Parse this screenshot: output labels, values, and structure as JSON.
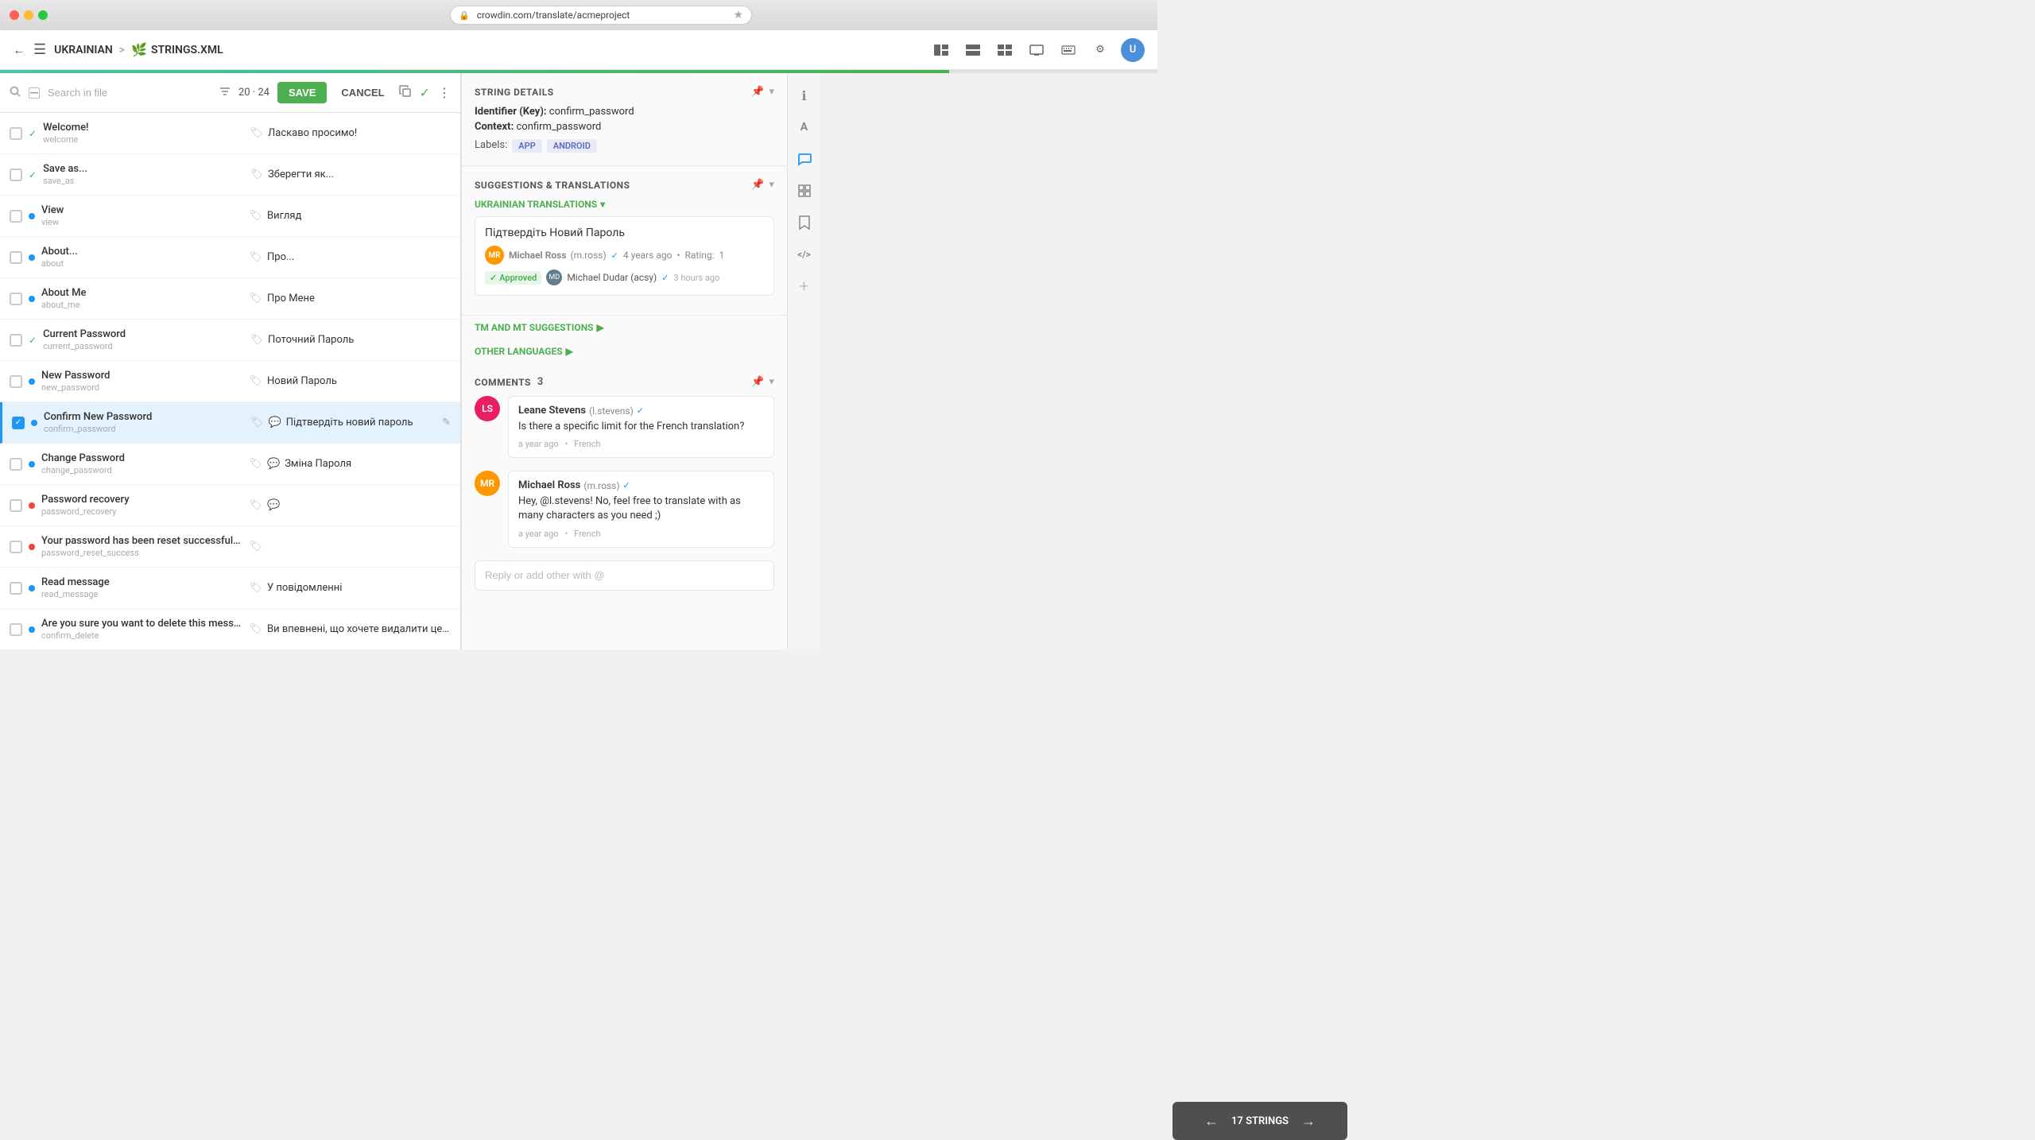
{
  "titlebar": {
    "url": "crowdin.com/translate/acmeproject",
    "star": "★"
  },
  "topbar": {
    "language": "UKRAINIAN",
    "separator": ">",
    "filename": "STRINGS.XML",
    "progress": 82
  },
  "searchbar": {
    "placeholder": "Search in file",
    "counter": "20 · 24",
    "save_label": "SAVE",
    "cancel_label": "CANCEL"
  },
  "strings": [
    {
      "id": 1,
      "key": "Welcome!",
      "slug": "welcome",
      "status": "approved",
      "translation": "Ласкаво просимо!",
      "hasTag": true,
      "hasComment": false
    },
    {
      "id": 2,
      "key": "Save as...",
      "slug": "save_as",
      "status": "approved",
      "translation": "Зберегти як...",
      "hasTag": true,
      "hasComment": false
    },
    {
      "id": 3,
      "key": "View",
      "slug": "view",
      "status": "blue",
      "translation": "Вигляд",
      "hasTag": true,
      "hasComment": false
    },
    {
      "id": 4,
      "key": "About...",
      "slug": "about",
      "status": "blue",
      "translation": "Про...",
      "hasTag": true,
      "hasComment": false
    },
    {
      "id": 5,
      "key": "About Me",
      "slug": "about_me",
      "status": "blue",
      "translation": "Про Мене",
      "hasTag": true,
      "hasComment": false
    },
    {
      "id": 6,
      "key": "Current Password",
      "slug": "current_password",
      "status": "approved",
      "translation": "Поточний Пароль",
      "hasTag": true,
      "hasComment": false
    },
    {
      "id": 7,
      "key": "New Password",
      "slug": "new_password",
      "status": "blue",
      "translation": "Новий Пароль",
      "hasTag": true,
      "hasComment": false
    },
    {
      "id": 8,
      "key": "Confirm New Password",
      "slug": "confirm_password",
      "status": "active",
      "translation": "Підтвердіть новий пароль",
      "hasTag": true,
      "hasComment": true,
      "isActive": true
    },
    {
      "id": 9,
      "key": "Change Password",
      "slug": "change_password",
      "status": "blue",
      "translation": "Зміна Пароля",
      "hasTag": true,
      "hasComment": true
    },
    {
      "id": 10,
      "key": "Password recovery",
      "slug": "password_recovery",
      "status": "red",
      "translation": "",
      "hasTag": true,
      "hasComment": true
    },
    {
      "id": 11,
      "key": "Your password has been reset successfully!",
      "slug": "password_reset_success",
      "status": "red",
      "translation": "",
      "hasTag": true,
      "hasComment": false
    },
    {
      "id": 12,
      "key": "Read message",
      "slug": "read_message",
      "status": "blue",
      "translation": "У повідомленні",
      "hasTag": true,
      "hasComment": false
    },
    {
      "id": 13,
      "key": "Are you sure you want to delete this message?",
      "slug": "confirm_delete",
      "status": "blue",
      "translation": "Ви впевнені, що хочете видалити це повідомлення?",
      "hasTag": true,
      "hasComment": false
    }
  ],
  "bottom_overlay": {
    "label": "17 STRINGS",
    "prev": "←",
    "next": "→"
  },
  "string_details": {
    "section_title": "STRING DETAILS",
    "identifier_label": "Identifier (Key):",
    "identifier_value": "confirm_password",
    "context_label": "Context:",
    "context_value": "confirm_password",
    "labels_title": "Labels:",
    "labels": [
      "APP",
      "ANDROID"
    ]
  },
  "suggestions": {
    "section_title": "SUGGESTIONS & TRANSLATIONS",
    "lang_label": "UKRAINIAN TRANSLATIONS",
    "suggestion_text": "Підтвердіть Новий Пароль",
    "author_name": "Michael Ross",
    "author_username": "(m.ross)",
    "time": "4 years ago",
    "rating_label": "Rating:",
    "rating": "1",
    "approved_label": "Approved",
    "approver_name": "Michael Dudar (acsy)",
    "approver_time": "3 hours ago",
    "tm_label": "TM AND MT SUGGESTIONS",
    "other_label": "OTHER LANGUAGES"
  },
  "comments": {
    "section_title": "COMMENTS",
    "count": "3",
    "items": [
      {
        "author_name": "Leane Stevens",
        "author_username": "(l.stevens)",
        "verified": true,
        "text": "Is there a specific limit for the French translation?",
        "time": "a year ago",
        "lang": "French",
        "initials": "LS"
      },
      {
        "author_name": "Michael Ross",
        "author_username": "(m.ross)",
        "verified": true,
        "text": "Hey, @l.stevens! No, feel free to translate with as many characters as you need ;)",
        "time": "a year ago",
        "lang": "French",
        "initials": "MR"
      }
    ],
    "reply_placeholder": "Reply or add other with @"
  },
  "far_right_icons": [
    {
      "name": "info-icon",
      "symbol": "ℹ",
      "active": false
    },
    {
      "name": "translate-icon",
      "symbol": "A",
      "active": false
    },
    {
      "name": "comments-icon",
      "symbol": "💬",
      "active": true
    },
    {
      "name": "history-icon",
      "symbol": "⊞",
      "active": false
    },
    {
      "name": "bookmark-icon",
      "symbol": "🔖",
      "active": false
    },
    {
      "name": "code-icon",
      "symbol": "&lt;&gt;",
      "active": false
    },
    {
      "name": "add-icon",
      "symbol": "+",
      "active": false
    }
  ]
}
